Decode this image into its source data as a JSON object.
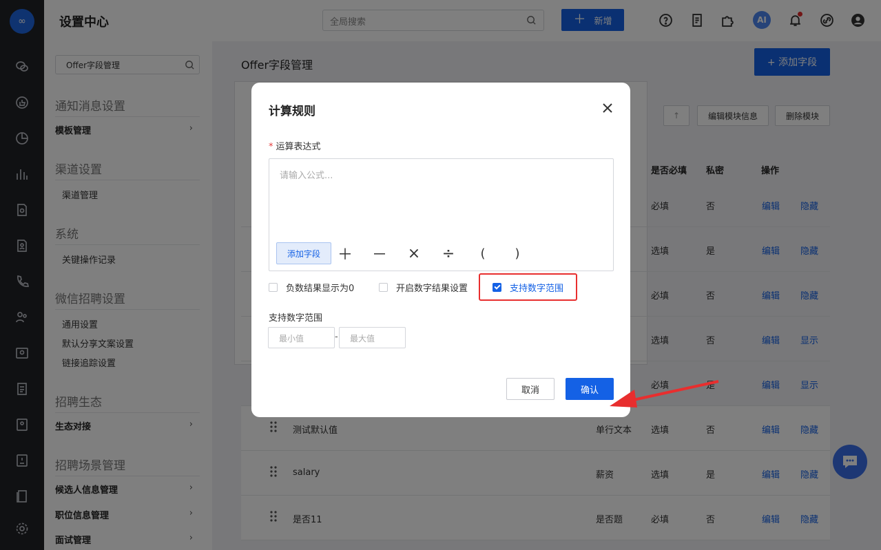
{
  "app": {
    "title": "设置中心",
    "logo_text": "∞"
  },
  "topbar": {
    "search_placeholder": "全局搜索",
    "new_label": "新增",
    "new_plus": "＋",
    "ai_label": "AI"
  },
  "sidenav": {
    "search_value": "Offer字段管理",
    "sections": {
      "notify": "通知消息设置",
      "template": "模板管理",
      "channel": "渠道设置",
      "channel_mgmt": "渠道管理",
      "system": "系统",
      "op_log": "关键操作记录",
      "wechat": "微信招聘设置",
      "general": "通用设置",
      "share_copy": "默认分享文案设置",
      "link_track": "链接追踪设置",
      "eco": "招聘生态",
      "eco_link": "生态对接",
      "scene": "招聘场景管理",
      "candidate": "候选人信息管理",
      "position": "职位信息管理",
      "interview": "面试管理"
    },
    "chevron": "›"
  },
  "main": {
    "page_title": "Offer字段管理",
    "add_field": "+ 添加字段",
    "up_arrow": "↑",
    "edit_module": "编辑模块信息",
    "delete_module": "删除模块",
    "headers": {
      "required": "是否必填",
      "private": "私密",
      "actions": "操作"
    },
    "rows": [
      {
        "name": "",
        "type": "",
        "required": "必填",
        "private": "否",
        "edit": "编辑",
        "toggle": "隐藏"
      },
      {
        "name": "",
        "type": "",
        "required": "选填",
        "private": "是",
        "edit": "编辑",
        "toggle": "隐藏"
      },
      {
        "name": "",
        "type": "",
        "required": "必填",
        "private": "否",
        "edit": "编辑",
        "toggle": "隐藏"
      },
      {
        "name": "",
        "type": "",
        "required": "选填",
        "private": "否",
        "edit": "编辑",
        "toggle": "显示"
      },
      {
        "name": "",
        "type": "",
        "required": "必填",
        "private": "是",
        "edit": "编辑",
        "toggle": "显示"
      },
      {
        "name": "测试默认值",
        "type": "单行文本",
        "required": "选填",
        "private": "否",
        "edit": "编辑",
        "toggle": "隐藏"
      },
      {
        "name": "salary",
        "type": "薪资",
        "required": "选填",
        "private": "是",
        "edit": "编辑",
        "toggle": "隐藏"
      },
      {
        "name": "是否11",
        "type": "是否题",
        "required": "必填",
        "private": "否",
        "edit": "编辑",
        "toggle": "隐藏"
      }
    ]
  },
  "modal": {
    "title": "计算规则",
    "close": "✕",
    "expr_label": "运算表达式",
    "required_mark": "*",
    "formula_placeholder": "请输入公式...",
    "add_field": "添加字段",
    "operators": [
      "＋",
      "－",
      "×",
      "÷",
      "(",
      ")"
    ],
    "checkboxes": [
      {
        "label": "负数结果显示为0",
        "checked": false
      },
      {
        "label": "开启数字结果设置",
        "checked": false
      },
      {
        "label": "支持数字范围",
        "checked": true
      }
    ],
    "range_label": "支持数字范围",
    "min_placeholder": "最小值",
    "max_placeholder": "最大值",
    "dash": "-",
    "cancel": "取消",
    "confirm": "确认"
  },
  "colors": {
    "primary": "#1461e5",
    "annotation_red": "#e82e2e",
    "rail": "#212327"
  }
}
